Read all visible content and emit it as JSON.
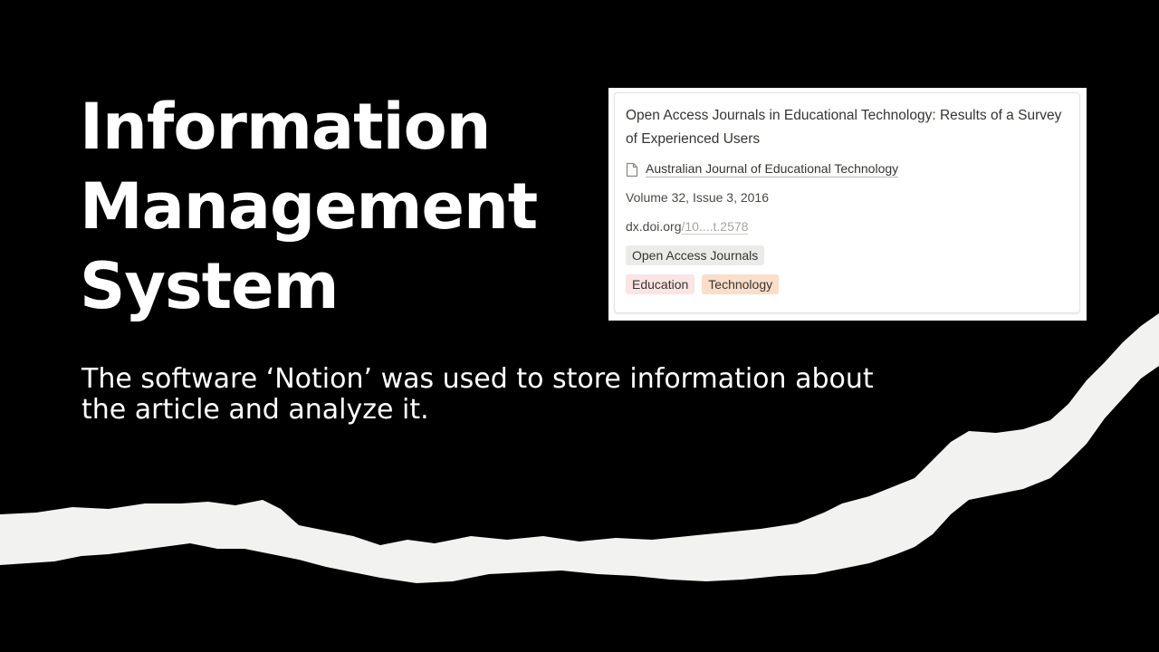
{
  "slide": {
    "title_lines": [
      "Information",
      "Management",
      "System"
    ],
    "subtitle": "The software ‘Notion’ was used to store information about the article and analyze it."
  },
  "card": {
    "title": "Open Access Journals in Educational Technology: Results of a Survey of Experienced Users",
    "journal_icon": "page-icon",
    "journal": "Australian Journal of Educational Technology",
    "volume": "Volume 32, Issue 3, 2016",
    "doi_host": "dx.doi.org",
    "doi_path": "/10....t.2578",
    "category_tag": "Open Access Journals",
    "topic_tags": [
      "Education",
      "Technology"
    ]
  },
  "colors": {
    "background": "#000000",
    "text": "#ffffff",
    "torn_paper": "#f2f2f0",
    "tag_gray": "#ebebea",
    "tag_red": "#fbe4e4",
    "tag_orange": "#fadec9"
  }
}
